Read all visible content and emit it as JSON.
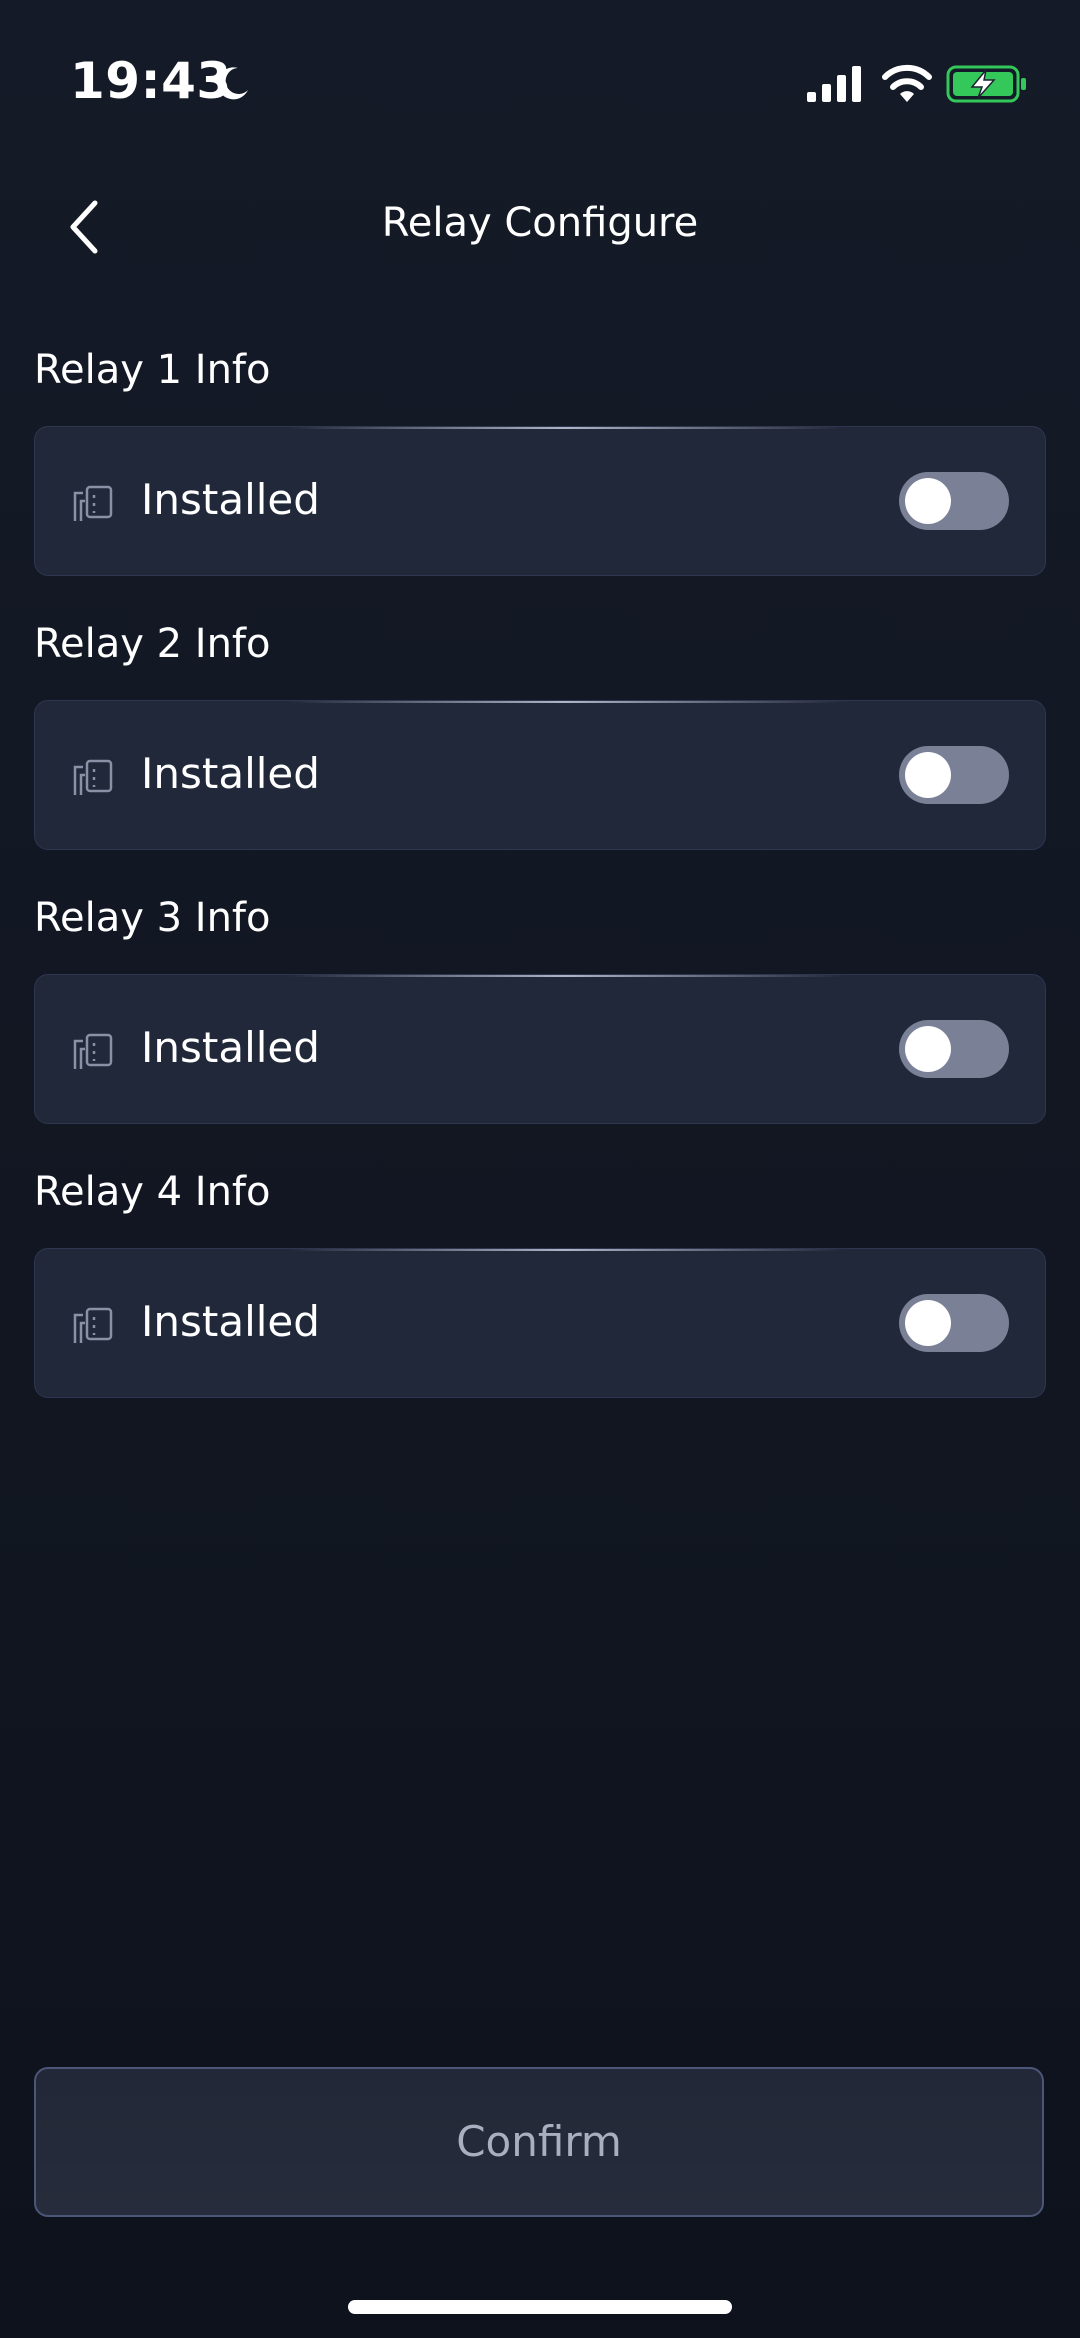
{
  "status_bar": {
    "time": "19:43",
    "icons": [
      "moon-icon",
      "cellular-signal-icon",
      "wifi-icon",
      "battery-charging-icon"
    ],
    "battery_color": "#34c759"
  },
  "header": {
    "title": "Relay Configure",
    "back_icon": "chevron-left-icon"
  },
  "relays": [
    {
      "title": "Relay 1 Info",
      "label": "Installed",
      "installed": false,
      "icon": "relay-module-icon"
    },
    {
      "title": "Relay 2 Info",
      "label": "Installed",
      "installed": false,
      "icon": "relay-module-icon"
    },
    {
      "title": "Relay 3 Info",
      "label": "Installed",
      "installed": false,
      "icon": "relay-module-icon"
    },
    {
      "title": "Relay 4 Info",
      "label": "Installed",
      "installed": false,
      "icon": "relay-module-icon"
    }
  ],
  "footer": {
    "confirm_label": "Confirm"
  },
  "colors": {
    "background": "#111622",
    "card": "#212839",
    "toggle_off": "#7a8197",
    "confirm_text": "#a9afbf"
  }
}
